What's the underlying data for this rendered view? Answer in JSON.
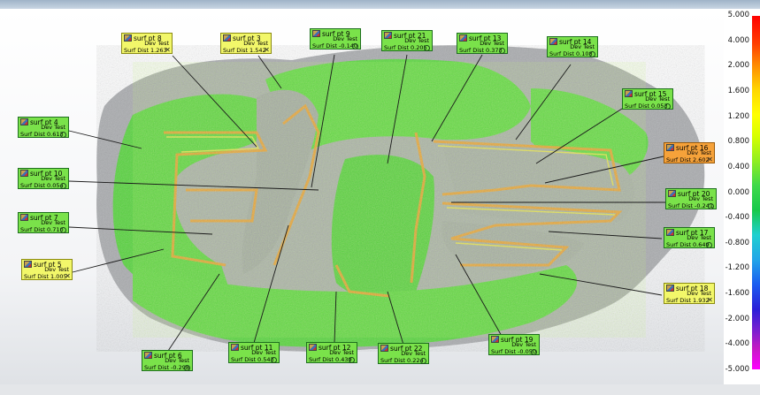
{
  "scale": {
    "ticks": [
      "5.000",
      "4.000",
      "2.000",
      "1.600",
      "1.200",
      "0.800",
      "0.400",
      "0.000",
      "-0.400",
      "-0.800",
      "-1.200",
      "-1.600",
      "-2.000",
      "-4.000",
      "-5.000"
    ]
  },
  "callouts": [
    {
      "id": "pt8",
      "label": "surf pt 8",
      "test": "Dev Test",
      "value_label": "Surf Dist",
      "value": "1.263",
      "status": "fail",
      "color": "yellow"
    },
    {
      "id": "pt3",
      "label": "surf pt 3",
      "test": "Dev Test",
      "value_label": "Surf Dist",
      "value": "1.542",
      "status": "fail",
      "color": "yellow"
    },
    {
      "id": "pt9",
      "label": "surf pt 9",
      "test": "Dev Test",
      "value_label": "Surf Dist",
      "value": "-0.140",
      "status": "pass",
      "color": "green"
    },
    {
      "id": "pt21",
      "label": "surf pt 21",
      "test": "Dev Test",
      "value_label": "Surf Dist",
      "value": "0.205",
      "status": "pass",
      "color": "green"
    },
    {
      "id": "pt13",
      "label": "surf pt 13",
      "test": "Dev Test",
      "value_label": "Surf Dist",
      "value": "0.373",
      "status": "pass",
      "color": "green"
    },
    {
      "id": "pt14",
      "label": "surf pt 14",
      "test": "Dev Test",
      "value_label": "Surf Dist",
      "value": "0.108",
      "status": "pass",
      "color": "green"
    },
    {
      "id": "pt15",
      "label": "surf pt 15",
      "test": "Dev Test",
      "value_label": "Surf Dist",
      "value": "0.053",
      "status": "pass",
      "color": "green"
    },
    {
      "id": "pt4",
      "label": "surf pt 4",
      "test": "Dev Test",
      "value_label": "Surf Dist",
      "value": "0.613",
      "status": "pass",
      "color": "green"
    },
    {
      "id": "pt16",
      "label": "surf pt 16",
      "test": "Dev Test",
      "value_label": "Surf Dist",
      "value": "2.602",
      "status": "fail",
      "color": "orange"
    },
    {
      "id": "pt10",
      "label": "surf pt 10",
      "test": "Dev Test",
      "value_label": "Surf Dist",
      "value": "0.054",
      "status": "pass",
      "color": "green"
    },
    {
      "id": "pt20",
      "label": "surf pt 20",
      "test": "Dev Test",
      "value_label": "Surf Dist",
      "value": "-0.241",
      "status": "pass",
      "color": "green"
    },
    {
      "id": "pt7",
      "label": "surf pt 7",
      "test": "Dev Test",
      "value_label": "Surf Dist",
      "value": "0.710",
      "status": "pass",
      "color": "green"
    },
    {
      "id": "pt17",
      "label": "surf pt 17",
      "test": "Dev Test",
      "value_label": "Surf Dist",
      "value": "0.649",
      "status": "pass",
      "color": "green"
    },
    {
      "id": "pt5",
      "label": "surf pt 5",
      "test": "Dev Test",
      "value_label": "Surf Dist",
      "value": "1.005",
      "status": "fail",
      "color": "yellow"
    },
    {
      "id": "pt18",
      "label": "surf pt 18",
      "test": "Dev Test",
      "value_label": "Surf Dist",
      "value": "1.932",
      "status": "fail",
      "color": "yellow"
    },
    {
      "id": "pt19",
      "label": "surf pt 19",
      "test": "Dev Test",
      "value_label": "Surf Dist",
      "value": "-0.050",
      "status": "pass",
      "color": "green"
    },
    {
      "id": "pt6",
      "label": "surf pt 6",
      "test": "Dev Test",
      "value_label": "Surf Dist",
      "value": "-0.298",
      "status": "pass",
      "color": "green"
    },
    {
      "id": "pt11",
      "label": "surf pt 11",
      "test": "Dev Test",
      "value_label": "Surf Dist",
      "value": "0.543",
      "status": "pass",
      "color": "green"
    },
    {
      "id": "pt12",
      "label": "surf pt 12",
      "test": "Dev Test",
      "value_label": "Surf Dist",
      "value": "0.439",
      "status": "pass",
      "color": "green"
    },
    {
      "id": "pt22",
      "label": "surf pt 22",
      "test": "Dev Test",
      "value_label": "Surf Dist",
      "value": "0.224",
      "status": "pass",
      "color": "green"
    }
  ],
  "colors": {
    "pass": "#7ae24a",
    "warn": "#f2f76a",
    "fail": "#f6a23a",
    "scan_green": "#52d63c",
    "scan_gray": "#a7a9ab",
    "edge_orange": "#f39b2c"
  }
}
